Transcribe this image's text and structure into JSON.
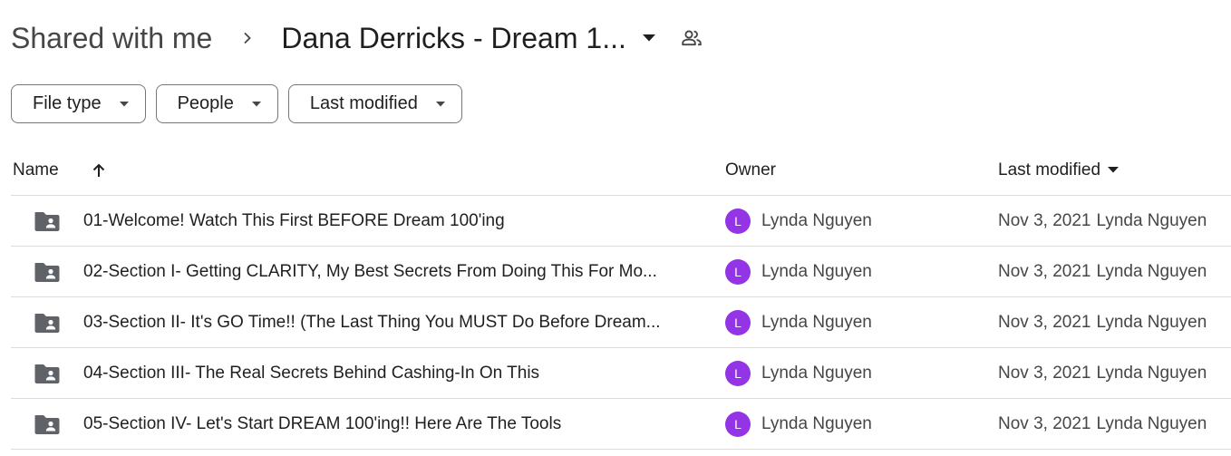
{
  "breadcrumb": {
    "root": "Shared with me",
    "current": "Dana Derricks - Dream 1..."
  },
  "filters": [
    {
      "label": "File type"
    },
    {
      "label": "People"
    },
    {
      "label": "Last modified"
    }
  ],
  "table": {
    "headers": {
      "name": "Name",
      "owner": "Owner",
      "last_modified": "Last modified"
    },
    "rows": [
      {
        "name": "01-Welcome! Watch This First BEFORE Dream 100'ing",
        "owner": "Lynda Nguyen",
        "owner_initial": "L",
        "date": "Nov 3, 2021",
        "modified_by": "Lynda Nguyen"
      },
      {
        "name": "02-Section I- Getting CLARITY, My Best Secrets From Doing This For Mo...",
        "owner": "Lynda Nguyen",
        "owner_initial": "L",
        "date": "Nov 3, 2021",
        "modified_by": "Lynda Nguyen"
      },
      {
        "name": "03-Section II- It's GO Time!! (The Last Thing You MUST Do Before Dream...",
        "owner": "Lynda Nguyen",
        "owner_initial": "L",
        "date": "Nov 3, 2021",
        "modified_by": "Lynda Nguyen"
      },
      {
        "name": "04-Section III- The Real Secrets Behind Cashing-In On This",
        "owner": "Lynda Nguyen",
        "owner_initial": "L",
        "date": "Nov 3, 2021",
        "modified_by": "Lynda Nguyen"
      },
      {
        "name": "05-Section IV- Let's Start DREAM 100'ing!! Here Are The Tools",
        "owner": "Lynda Nguyen",
        "owner_initial": "L",
        "date": "Nov 3, 2021",
        "modified_by": "Lynda Nguyen"
      }
    ]
  },
  "icons": {
    "breadcrumb_separator": "chevron-right-icon",
    "folder_menu": "caret-down-icon",
    "shared": "people-icon",
    "sort_name": "arrow-up-icon",
    "sort_modified": "caret-down-icon",
    "row_type": "shared-folder-icon"
  },
  "colors": {
    "avatar": "#9334e6",
    "folder_icon": "#5f6368",
    "border": "#dadce0",
    "chip_border": "#747775"
  }
}
